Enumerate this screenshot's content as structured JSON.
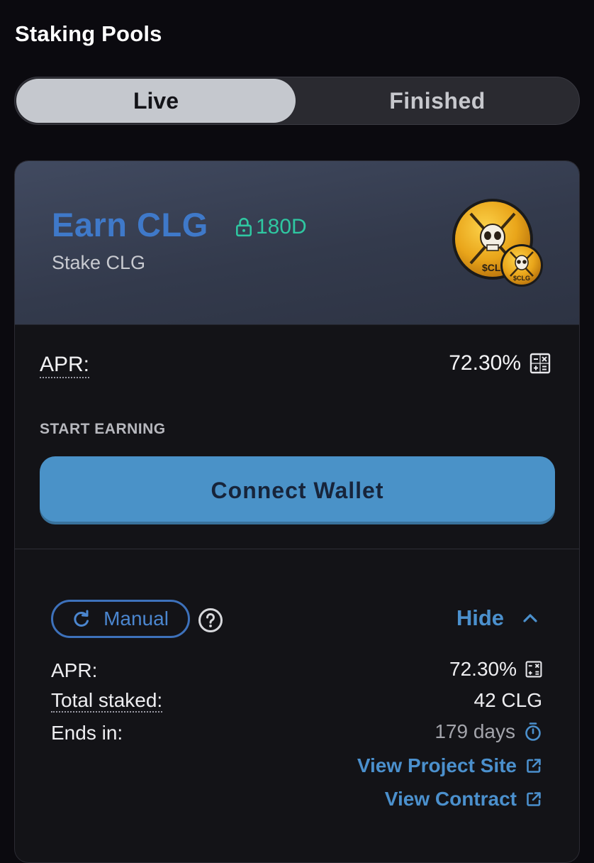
{
  "page": {
    "title": "Staking Pools"
  },
  "tabs": {
    "live": "Live",
    "finished": "Finished",
    "active": "Live"
  },
  "pool": {
    "title": "Earn CLG",
    "lock_label": "180D",
    "subtitle": "Stake CLG",
    "token_logo": {
      "icon": "skull-swords-token-icon",
      "text": "$CLG"
    }
  },
  "apr": {
    "label": "APR:",
    "value": "72.30%"
  },
  "start_earning": {
    "label": "START EARNING",
    "button": "Connect Wallet"
  },
  "details": {
    "manual_label": "Manual",
    "hide_label": "Hide",
    "rows": [
      {
        "label": "APR:",
        "value": "72.30%"
      },
      {
        "label": "Total staked:",
        "value": "42 CLG"
      },
      {
        "label": "Ends in:",
        "value": "179 days"
      }
    ],
    "links": {
      "project": "View Project Site",
      "contract": "View Contract"
    }
  },
  "colors": {
    "background": "#0b0a0f",
    "accent_blue": "#4a92c8",
    "title_blue": "#3f79c9",
    "lock_green": "#2fc7a1",
    "card": "#131317"
  }
}
